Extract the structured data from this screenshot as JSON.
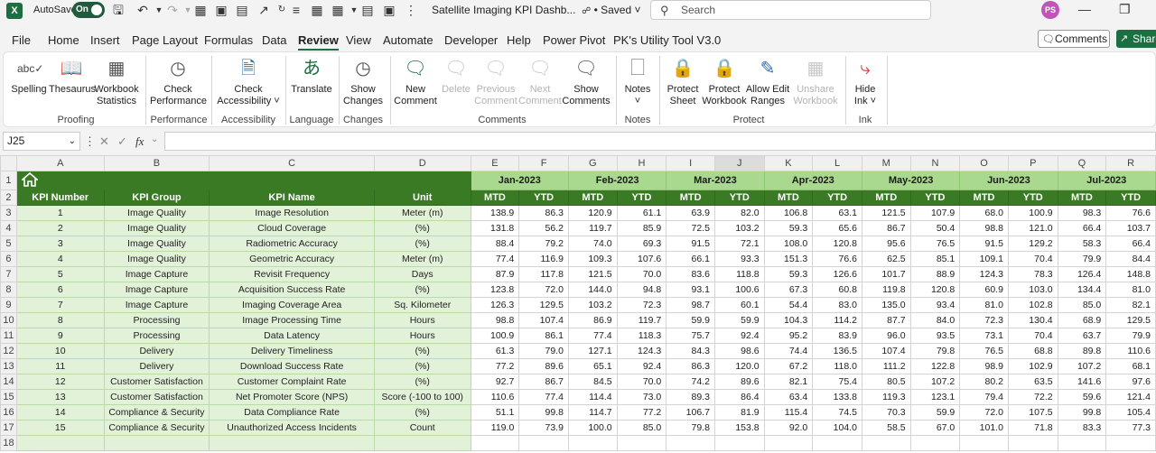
{
  "titlebar": {
    "app_logo": "X",
    "autosave_label": "AutoSave",
    "autosave_state": "On",
    "doc_title": "Satellite Imaging KPI Dashb...",
    "saved_status": "• Saved",
    "search_placeholder": "Search",
    "avatar_initials": "PS"
  },
  "menu": {
    "tabs": [
      "File",
      "Home",
      "Insert",
      "Page Layout",
      "Formulas",
      "Data",
      "Review",
      "View",
      "Automate",
      "Developer",
      "Help",
      "Power Pivot",
      "PK's Utility Tool V3.0"
    ],
    "active_tab": "Review",
    "comments_label": "Comments",
    "share_label": "Share"
  },
  "ribbon": {
    "buttons": {
      "spelling": "Spelling",
      "thesaurus": "Thesaurus",
      "workbook_statistics_1": "Workbook",
      "workbook_statistics_2": "Statistics",
      "check_performance_1": "Check",
      "check_performance_2": "Performance",
      "check_accessibility_1": "Check",
      "check_accessibility_2": "Accessibility ˅",
      "translate": "Translate",
      "show_changes_1": "Show",
      "show_changes_2": "Changes",
      "new_comment_1": "New",
      "new_comment_2": "Comment",
      "delete": "Delete",
      "previous_comment_1": "Previous",
      "previous_comment_2": "Comment",
      "next_comment_1": "Next",
      "next_comment_2": "Comment",
      "show_comments_1": "Show",
      "show_comments_2": "Comments",
      "notes_1": "Notes",
      "notes_2": "˅",
      "protect_sheet_1": "Protect",
      "protect_sheet_2": "Sheet",
      "protect_workbook_1": "Protect",
      "protect_workbook_2": "Workbook",
      "allow_edit_ranges_1": "Allow Edit",
      "allow_edit_ranges_2": "Ranges",
      "unshare_workbook_1": "Unshare",
      "unshare_workbook_2": "Workbook",
      "hide_ink_1": "Hide",
      "hide_ink_2": "Ink ˅"
    },
    "groups": {
      "proofing": "Proofing",
      "performance": "Performance",
      "accessibility": "Accessibility",
      "language": "Language",
      "changes": "Changes",
      "comments": "Comments",
      "notes": "Notes",
      "protect": "Protect",
      "ink": "Ink"
    }
  },
  "formula_bar": {
    "name_box": "J25",
    "fx_label": "fx",
    "value": ""
  },
  "sheet": {
    "column_letters": [
      "A",
      "B",
      "C",
      "D",
      "E",
      "F",
      "G",
      "H",
      "I",
      "J",
      "K",
      "L",
      "M",
      "N",
      "O",
      "P",
      "Q",
      "R"
    ],
    "row_numbers": [
      "1",
      "2",
      "3",
      "4",
      "5",
      "6",
      "7",
      "8",
      "9",
      "10",
      "11",
      "12",
      "13",
      "14",
      "15",
      "16",
      "17",
      "18"
    ],
    "months": [
      "Jan-2023",
      "Feb-2023",
      "Mar-2023",
      "Apr-2023",
      "May-2023",
      "Jun-2023",
      "Jul-2023"
    ],
    "headers": [
      "KPI Number",
      "KPI Group",
      "KPI Name",
      "Unit"
    ],
    "mtd_label": "MTD",
    "ytd_label": "YTD",
    "rows": [
      {
        "num": "1",
        "group": "Image Quality",
        "name": "Image Resolution",
        "unit": "Meter (m)",
        "vals": [
          "138.9",
          "86.3",
          "120.9",
          "61.1",
          "63.9",
          "82.0",
          "106.8",
          "63.1",
          "121.5",
          "107.9",
          "68.0",
          "100.9",
          "98.3",
          "76.6"
        ]
      },
      {
        "num": "2",
        "group": "Image Quality",
        "name": "Cloud Coverage",
        "unit": "(%)",
        "vals": [
          "131.8",
          "56.2",
          "119.7",
          "85.9",
          "72.5",
          "103.2",
          "59.3",
          "65.6",
          "86.7",
          "50.4",
          "98.8",
          "121.0",
          "66.4",
          "103.7"
        ]
      },
      {
        "num": "3",
        "group": "Image Quality",
        "name": "Radiometric Accuracy",
        "unit": "(%)",
        "vals": [
          "88.4",
          "79.2",
          "74.0",
          "69.3",
          "91.5",
          "72.1",
          "108.0",
          "120.8",
          "95.6",
          "76.5",
          "91.5",
          "129.2",
          "58.3",
          "66.4"
        ]
      },
      {
        "num": "4",
        "group": "Image Quality",
        "name": "Geometric Accuracy",
        "unit": "Meter (m)",
        "vals": [
          "77.4",
          "116.9",
          "109.3",
          "107.6",
          "66.1",
          "93.3",
          "151.3",
          "76.6",
          "62.5",
          "85.1",
          "109.1",
          "70.4",
          "79.9",
          "84.4"
        ]
      },
      {
        "num": "5",
        "group": "Image Capture",
        "name": "Revisit Frequency",
        "unit": "Days",
        "vals": [
          "87.9",
          "117.8",
          "121.5",
          "70.0",
          "83.6",
          "118.8",
          "59.3",
          "126.6",
          "101.7",
          "88.9",
          "124.3",
          "78.3",
          "126.4",
          "148.8"
        ]
      },
      {
        "num": "6",
        "group": "Image Capture",
        "name": "Acquisition Success Rate",
        "unit": "(%)",
        "vals": [
          "123.8",
          "72.0",
          "144.0",
          "94.8",
          "93.1",
          "100.6",
          "67.3",
          "60.8",
          "119.8",
          "120.8",
          "60.9",
          "103.0",
          "134.4",
          "81.0"
        ]
      },
      {
        "num": "7",
        "group": "Image Capture",
        "name": "Imaging Coverage Area",
        "unit": "Sq. Kilometer",
        "vals": [
          "126.3",
          "129.5",
          "103.2",
          "72.3",
          "98.7",
          "60.1",
          "54.4",
          "83.0",
          "135.0",
          "93.4",
          "81.0",
          "102.8",
          "85.0",
          "82.1"
        ]
      },
      {
        "num": "8",
        "group": "Processing",
        "name": "Image Processing Time",
        "unit": "Hours",
        "vals": [
          "98.8",
          "107.4",
          "86.9",
          "119.7",
          "59.9",
          "59.9",
          "104.3",
          "114.2",
          "87.7",
          "84.0",
          "72.3",
          "130.4",
          "68.9",
          "129.5"
        ]
      },
      {
        "num": "9",
        "group": "Processing",
        "name": "Data Latency",
        "unit": "Hours",
        "vals": [
          "100.9",
          "86.1",
          "77.4",
          "118.3",
          "75.7",
          "92.4",
          "95.2",
          "83.9",
          "96.0",
          "93.5",
          "73.1",
          "70.4",
          "63.7",
          "79.9"
        ]
      },
      {
        "num": "10",
        "group": "Delivery",
        "name": "Delivery Timeliness",
        "unit": "(%)",
        "vals": [
          "61.3",
          "79.0",
          "127.1",
          "124.3",
          "84.3",
          "98.6",
          "74.4",
          "136.5",
          "107.4",
          "79.8",
          "76.5",
          "68.8",
          "89.8",
          "110.6"
        ]
      },
      {
        "num": "11",
        "group": "Delivery",
        "name": "Download Success Rate",
        "unit": "(%)",
        "vals": [
          "77.2",
          "89.6",
          "65.1",
          "92.4",
          "86.3",
          "120.0",
          "67.2",
          "118.0",
          "111.2",
          "122.8",
          "98.9",
          "102.9",
          "107.2",
          "68.1"
        ]
      },
      {
        "num": "12",
        "group": "Customer Satisfaction",
        "name": "Customer Complaint Rate",
        "unit": "(%)",
        "vals": [
          "92.7",
          "86.7",
          "84.5",
          "70.0",
          "74.2",
          "89.6",
          "82.1",
          "75.4",
          "80.5",
          "107.2",
          "80.2",
          "63.5",
          "141.6",
          "97.6"
        ]
      },
      {
        "num": "13",
        "group": "Customer Satisfaction",
        "name": "Net Promoter Score (NPS)",
        "unit": "Score (-100 to 100)",
        "vals": [
          "110.6",
          "77.4",
          "114.4",
          "73.0",
          "89.3",
          "86.4",
          "63.4",
          "133.8",
          "119.3",
          "123.1",
          "79.4",
          "72.2",
          "59.6",
          "121.4"
        ]
      },
      {
        "num": "14",
        "group": "Compliance & Security",
        "name": "Data Compliance Rate",
        "unit": "(%)",
        "vals": [
          "51.1",
          "99.8",
          "114.7",
          "77.2",
          "106.7",
          "81.9",
          "115.4",
          "74.5",
          "70.3",
          "59.9",
          "72.0",
          "107.5",
          "99.8",
          "105.4"
        ]
      },
      {
        "num": "15",
        "group": "Compliance & Security",
        "name": "Unauthorized Access Incidents",
        "unit": "Count",
        "vals": [
          "119.0",
          "73.9",
          "100.0",
          "85.0",
          "79.8",
          "153.8",
          "92.0",
          "104.0",
          "58.5",
          "67.0",
          "101.0",
          "71.8",
          "83.3",
          "77.3"
        ]
      }
    ]
  }
}
